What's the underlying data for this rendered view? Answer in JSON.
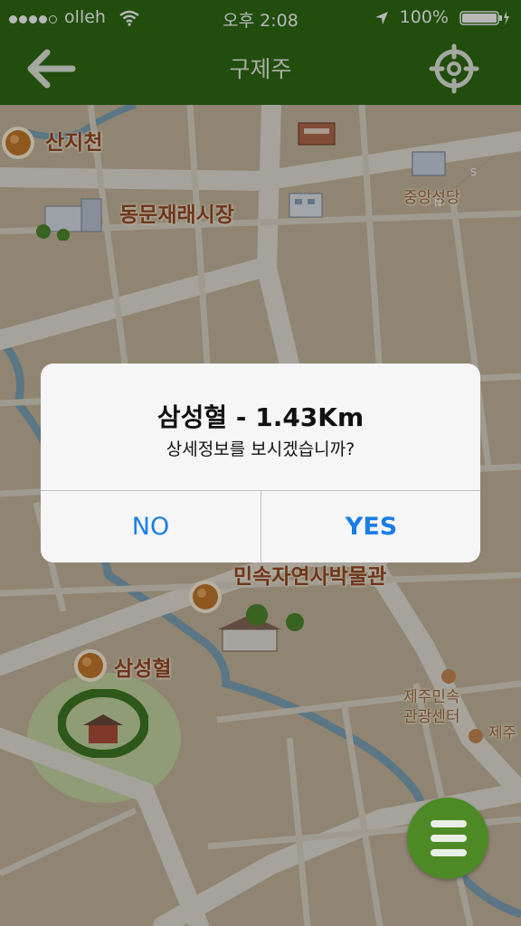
{
  "status_bar": {
    "carrier": "olleh",
    "time": "오후 2:08",
    "battery": "100%"
  },
  "nav": {
    "title": "구제주",
    "back_icon": "arrow-left-icon",
    "locate_icon": "crosshair-icon"
  },
  "map": {
    "pois": {
      "sanjicheon": "산지천",
      "dongmun": "동문재래시장",
      "jungang": "중앙성당",
      "museum": "민속자연사박물관",
      "samseonghyeol": "삼성혈",
      "jeju_folk_line1": "제주민속",
      "jeju_folk_line2": "관광센터",
      "jeju_right": "제주"
    },
    "compass_icon": "compass-icon"
  },
  "alert": {
    "title": "삼성혈 - 1.43Km",
    "message": "상세정보를 보시겠습니까?",
    "no_label": "NO",
    "yes_label": "YES"
  },
  "menu_button_icon": "hamburger-menu-icon",
  "colors": {
    "nav_green": "#2f6b13",
    "fab_green": "#4d8a26",
    "ios_blue": "#1a7ee6"
  }
}
